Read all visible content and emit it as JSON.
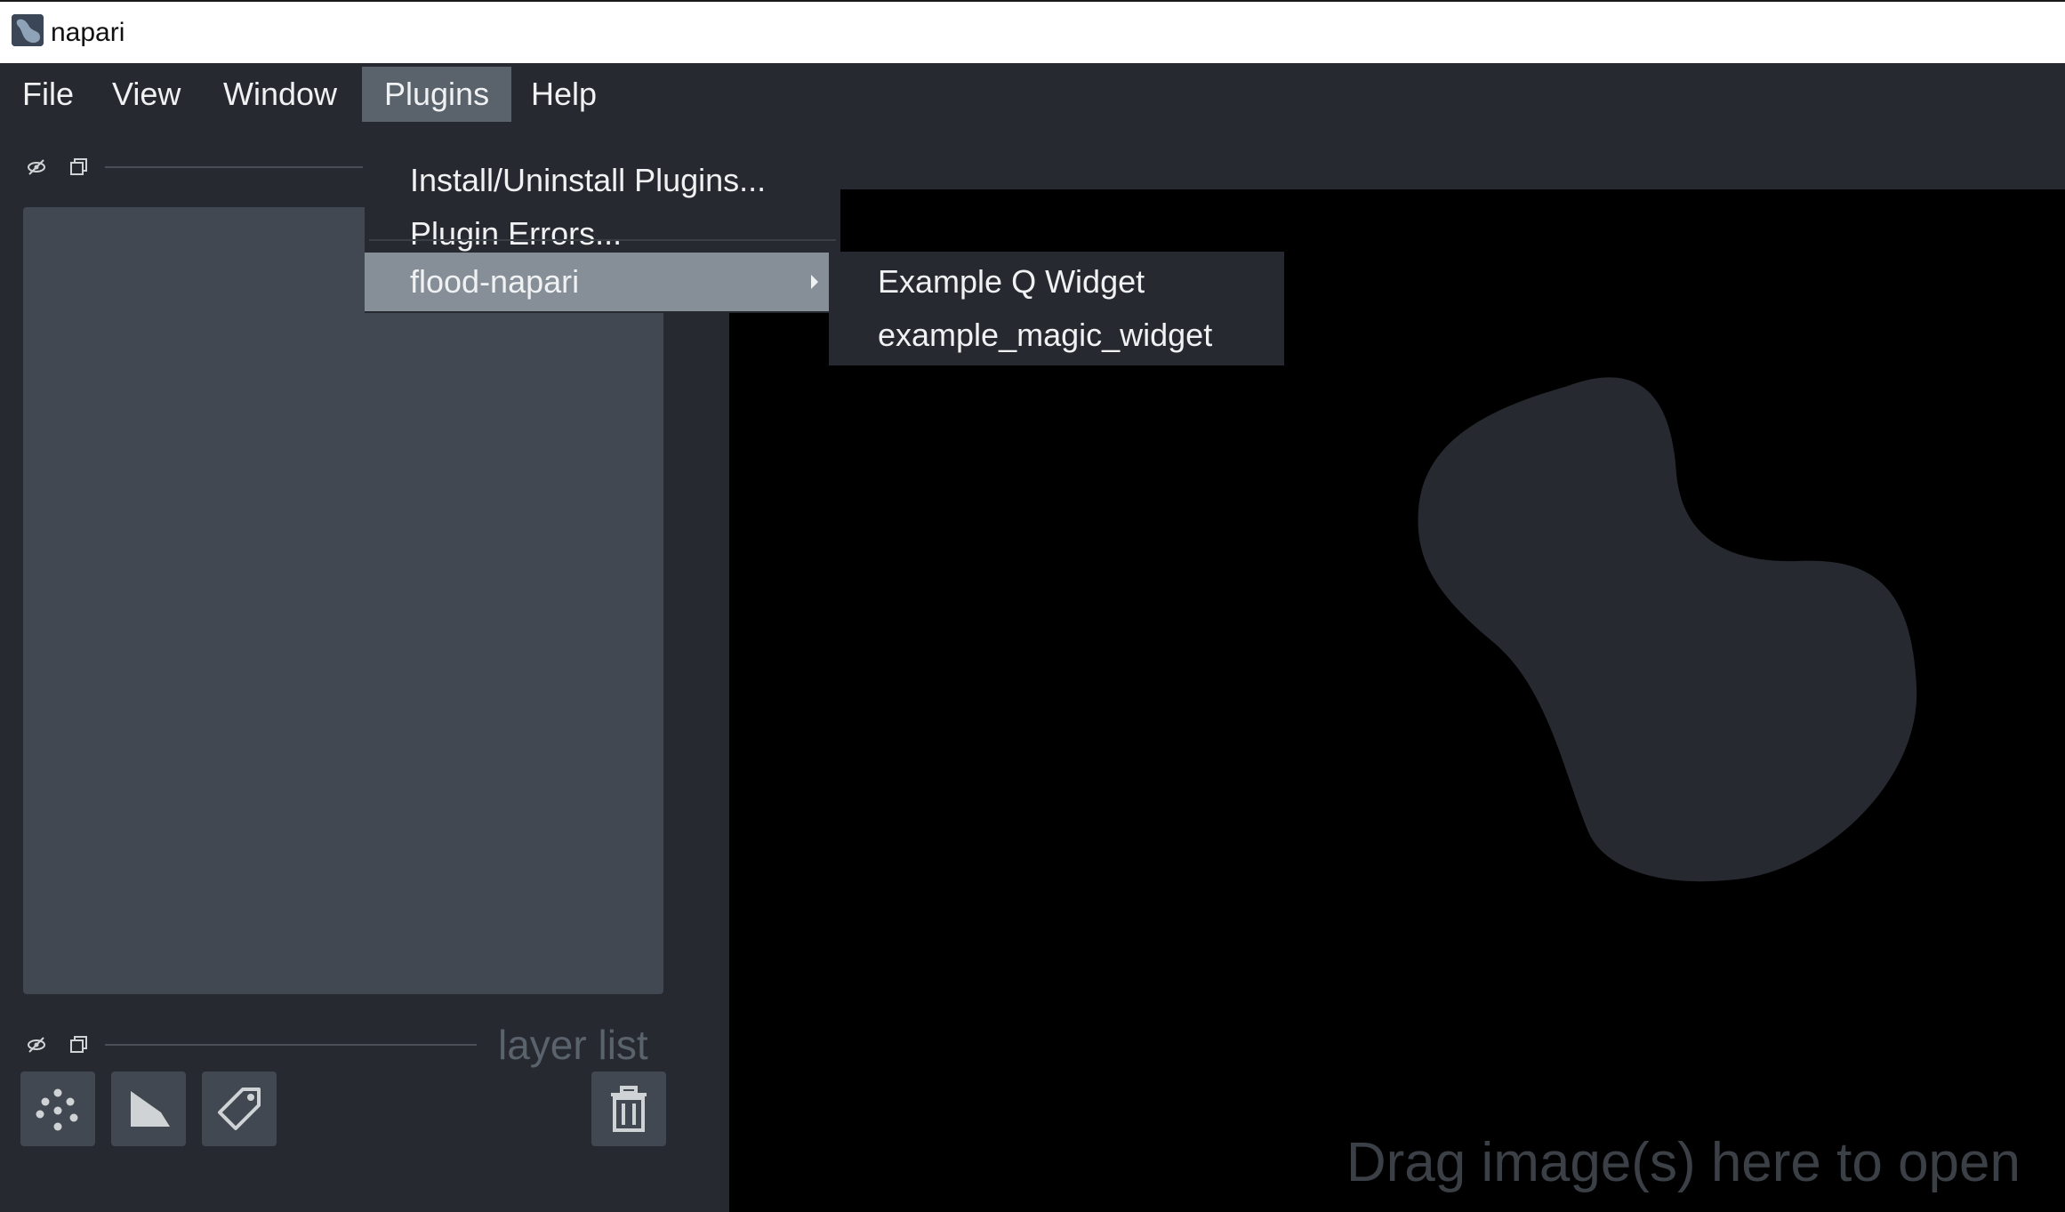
{
  "window": {
    "title": "napari"
  },
  "menubar": {
    "items": [
      {
        "label": "File"
      },
      {
        "label": "View"
      },
      {
        "label": "Window"
      },
      {
        "label": "Plugins"
      },
      {
        "label": "Help"
      }
    ],
    "active": "Plugins"
  },
  "plugins_menu": {
    "items": [
      {
        "label": "Install/Uninstall Plugins..."
      },
      {
        "label": "Plugin Errors..."
      },
      {
        "label": "flood-napari",
        "has_submenu": true
      }
    ],
    "highlighted": "flood-napari"
  },
  "submenu": {
    "items": [
      {
        "label": "Example Q Widget"
      },
      {
        "label": "example_magic_widget"
      }
    ]
  },
  "layer_list_dock": {
    "title": "layer list"
  },
  "layer_buttons": {
    "new_points": "points-icon",
    "new_shapes": "shapes-icon",
    "new_labels": "labels-icon",
    "delete": "trash-icon"
  },
  "canvas": {
    "drop_hint": "Drag image(s) here to open",
    "background": "#000000",
    "logo_color": "#262930"
  },
  "colors": {
    "panel": "#262930",
    "control": "#414851",
    "highlight": "#868e97",
    "text": "#f0f1f2"
  }
}
